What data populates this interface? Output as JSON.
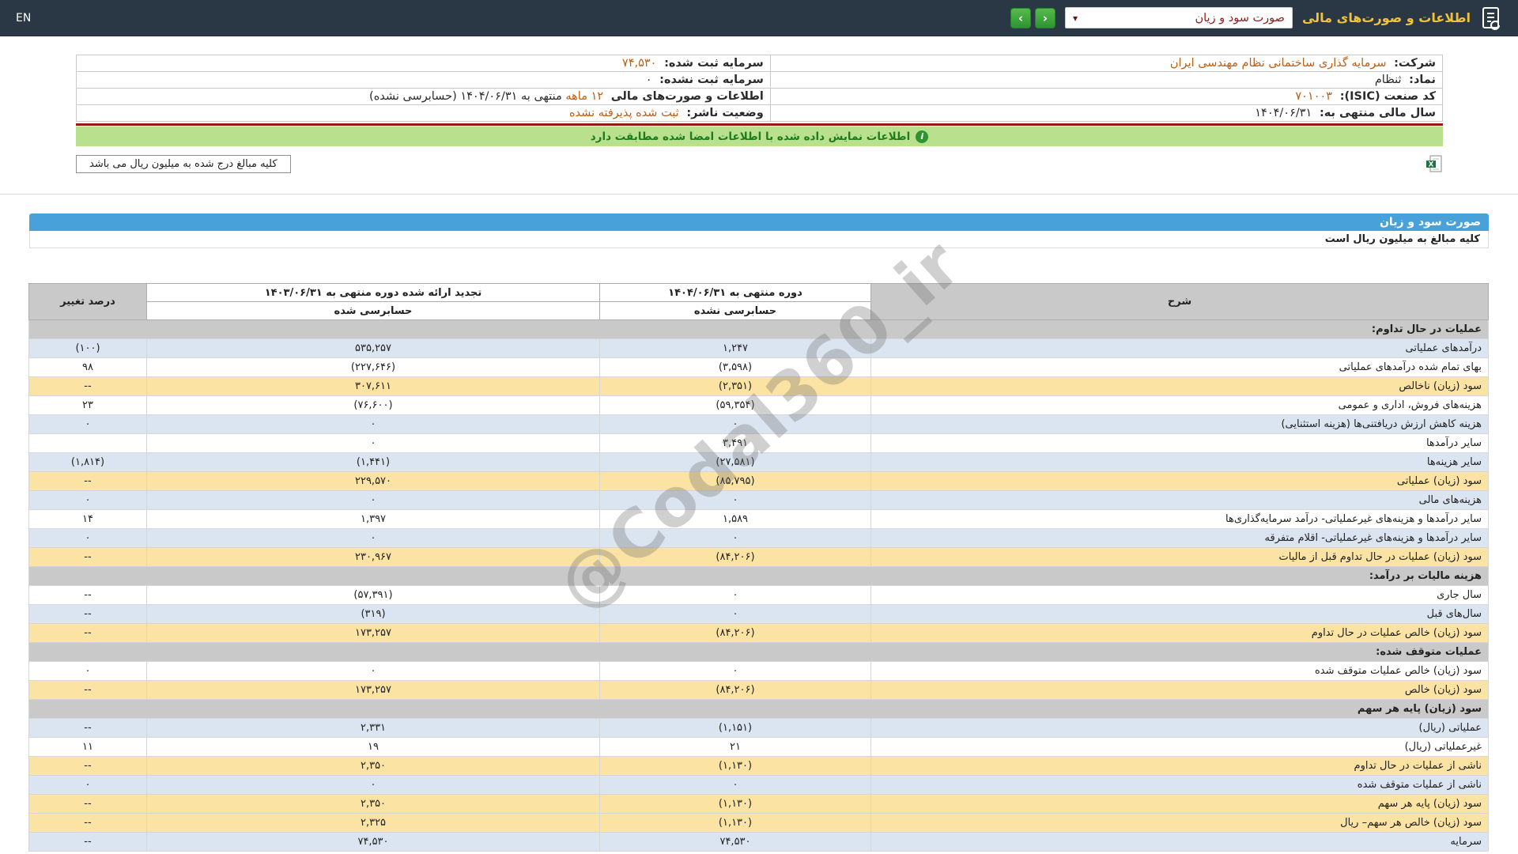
{
  "header": {
    "title": "اطلاعات و صورت‌های مالی",
    "report_select_value": "صورت سود و زیان",
    "select_caret": "▾",
    "nav_next_glyph": "›",
    "nav_prev_glyph": "‹",
    "en_label": "EN"
  },
  "company_info": {
    "company_label": "شرکت:",
    "company_value": "سرمایه گذاری ساختمانی نظام مهندسی ایران",
    "symbol_label": "نماد:",
    "symbol_value": "ثنظام",
    "isic_label": "کد صنعت (ISIC):",
    "isic_value": "۷۰۱۰۰۳",
    "fiscal_year_label": "سال مالی منتهی به:",
    "fiscal_year_value": "۱۴۰۴/۰۶/۳۱",
    "registered_capital_label": "سرمایه ثبت شده:",
    "registered_capital_value": "۷۴,۵۳۰",
    "unregistered_capital_label": "سرمایه ثبت نشده:",
    "unregistered_capital_value": "۰",
    "period_prefix": "اطلاعات و صورت‌های مالی",
    "period_months": "۱۲ ماهه",
    "period_middle": "منتهی به",
    "period_date": "۱۴۰۴/۰۶/۳۱",
    "period_suffix": "(حسابرسی نشده)",
    "publisher_status_label": "وضعیت ناشر:",
    "publisher_status_value": "ثبت شده پذیرفته نشده"
  },
  "signature_banner": {
    "icon_glyph": "i",
    "text": "اطلاعات نمایش داده شده با اطلاعات امضا شده مطابقت دارد"
  },
  "amounts_note": "کلیه مبالغ درج شده به میلیون ریال می باشد",
  "statement": {
    "title": "صورت سود و زیان",
    "subtitle": "کلیه مبالغ به میلیون ریال است",
    "watermark": "@Codal360_ir",
    "columns": {
      "desc": "شرح",
      "current_title": "دوره منتهی به ۱۴۰۴/۰۶/۳۱",
      "current_sub": "حسابرسی نشده",
      "prior_title": "تجدید ارائه شده دوره منتهی به ۱۴۰۳/۰۶/۳۱",
      "prior_sub": "حسابرسی شده",
      "change": "درصد تغییر"
    },
    "rows": [
      {
        "type": "section",
        "label": "عملیات در حال تداوم:"
      },
      {
        "type": "blue",
        "label": "درآمدهای عملیاتی",
        "current": "۱,۲۴۷",
        "prior": "۵۳۵,۲۵۷",
        "change": "(۱۰۰)"
      },
      {
        "type": "white",
        "label": "بهای تمام شده درآمدهای عملیاتی",
        "current": "(۳,۵۹۸)",
        "prior": "(۲۲۷,۶۴۶)",
        "change": "۹۸"
      },
      {
        "type": "yellow",
        "label": "سود (زیان) ناخالص",
        "current": "(۲,۳۵۱)",
        "prior": "۳۰۷,۶۱۱",
        "change": "--"
      },
      {
        "type": "white",
        "label": "هزینه‌های فروش، اداری و عمومی",
        "current": "(۵۹,۳۵۴)",
        "prior": "(۷۶,۶۰۰)",
        "change": "۲۳"
      },
      {
        "type": "blue",
        "label": "هزینه کاهش ارزش دریافتنی‌ها (هزینه استثنایی)",
        "current": "۰",
        "prior": "۰",
        "change": "۰"
      },
      {
        "type": "white",
        "label": "سایر درآمدها",
        "current": "۳,۴۹۱",
        "prior": "۰",
        "change": ""
      },
      {
        "type": "blue",
        "label": "سایر هزینه‌ها",
        "current": "(۲۷,۵۸۱)",
        "prior": "(۱,۴۴۱)",
        "change": "(۱,۸۱۴)"
      },
      {
        "type": "yellow",
        "label": "سود (زیان) عملیاتی",
        "current": "(۸۵,۷۹۵)",
        "prior": "۲۲۹,۵۷۰",
        "change": "--"
      },
      {
        "type": "blue",
        "label": "هزینه‌های مالی",
        "current": "۰",
        "prior": "۰",
        "change": "۰"
      },
      {
        "type": "white",
        "label": "سایر درآمدها و هزینه‌های غیرعملیاتی- درآمد سرمایه‌گذاری‌ها",
        "current": "۱,۵۸۹",
        "prior": "۱,۳۹۷",
        "change": "۱۴"
      },
      {
        "type": "blue",
        "label": "سایر درآمدها و هزینه‌های غیرعملیاتی- اقلام متفرقه",
        "current": "۰",
        "prior": "۰",
        "change": "۰"
      },
      {
        "type": "yellow",
        "label": "سود (زیان) عملیات در حال تداوم قبل از مالیات",
        "current": "(۸۴,۲۰۶)",
        "prior": "۲۳۰,۹۶۷",
        "change": "--"
      },
      {
        "type": "section",
        "label": "هزینه مالیات بر درآمد:"
      },
      {
        "type": "white",
        "label": "سال جاری",
        "current": "۰",
        "prior": "(۵۷,۳۹۱)",
        "change": "--"
      },
      {
        "type": "blue",
        "label": "سال‌های قبل",
        "current": "۰",
        "prior": "(۳۱۹)",
        "change": "--"
      },
      {
        "type": "yellow",
        "label": "سود (زیان) خالص عملیات در حال تداوم",
        "current": "(۸۴,۲۰۶)",
        "prior": "۱۷۳,۲۵۷",
        "change": "--"
      },
      {
        "type": "section",
        "label": "عملیات متوقف شده:"
      },
      {
        "type": "white",
        "label": "سود (زیان) خالص عملیات متوقف شده",
        "current": "۰",
        "prior": "۰",
        "change": "۰"
      },
      {
        "type": "yellow",
        "label": "سود (زیان) خالص",
        "current": "(۸۴,۲۰۶)",
        "prior": "۱۷۳,۲۵۷",
        "change": "--"
      },
      {
        "type": "section",
        "label": "سود (زیان) پایه هر سهم"
      },
      {
        "type": "blue",
        "label": "عملیاتی (ریال)",
        "current": "(۱,۱۵۱)",
        "prior": "۲,۳۳۱",
        "change": "--"
      },
      {
        "type": "white",
        "label": "غیرعملیاتی (ریال)",
        "current": "۲۱",
        "prior": "۱۹",
        "change": "۱۱"
      },
      {
        "type": "yellow",
        "label": "ناشی از عملیات در حال تداوم",
        "current": "(۱,۱۳۰)",
        "prior": "۲,۳۵۰",
        "change": "--"
      },
      {
        "type": "blue",
        "label": "ناشی از عملیات متوقف شده",
        "current": "۰",
        "prior": "۰",
        "change": "۰"
      },
      {
        "type": "yellow",
        "label": "سود (زیان) پایه هر سهم",
        "current": "(۱,۱۳۰)",
        "prior": "۲,۳۵۰",
        "change": "--"
      },
      {
        "type": "yellow",
        "label": "سود (زیان) خالص هر سهم– ریال",
        "current": "(۱,۱۳۰)",
        "prior": "۲,۳۲۵",
        "change": "--"
      },
      {
        "type": "blue",
        "label": "سرمایه",
        "current": "۷۴,۵۳۰",
        "prior": "۷۴,۵۳۰",
        "change": "--"
      }
    ]
  },
  "colors": {
    "topbar_navy": "#2a3744",
    "title_gold": "#eec23e",
    "select_maroon": "#8b1e1e",
    "nav_green": "#2f9331",
    "accent_orange": "#c05e12",
    "red_line": "#8f1d1d",
    "banner_green_bg": "#b9e08d",
    "banner_green_text": "#1e7b1e",
    "header_blue": "#48a2d9",
    "band_blue": "#dbe5f1",
    "highlight_yellow": "#fbe3a3",
    "section_gray": "#c9c9c9",
    "negative_red": "#cc1212"
  }
}
